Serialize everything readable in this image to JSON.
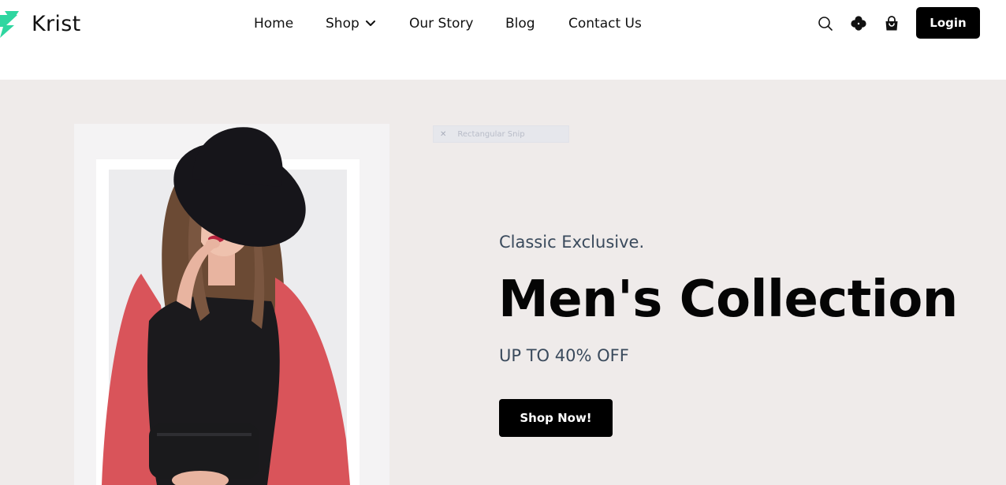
{
  "brand": {
    "name": "Krist",
    "logo_icon": "lightning-logo-icon",
    "accent_color": "#2fd6a0"
  },
  "nav": {
    "items": [
      {
        "label": "Home"
      },
      {
        "label": "Shop",
        "icon": "chevron-down-icon"
      },
      {
        "label": "Our Story"
      },
      {
        "label": "Blog"
      },
      {
        "label": "Contact Us"
      }
    ]
  },
  "header_actions": {
    "icons": [
      "search-icon",
      "clover-icon",
      "shopping-bag-icon"
    ],
    "login_label": "Login"
  },
  "hero": {
    "snip_overlay": "Rectangular Snip",
    "kicker": "Classic Exclusive.",
    "title": "Men's Collection",
    "discount": "UP TO 40% OFF",
    "cta_label": "Shop Now!",
    "background_color": "#efebea",
    "text_color": "#3a4a5c"
  }
}
